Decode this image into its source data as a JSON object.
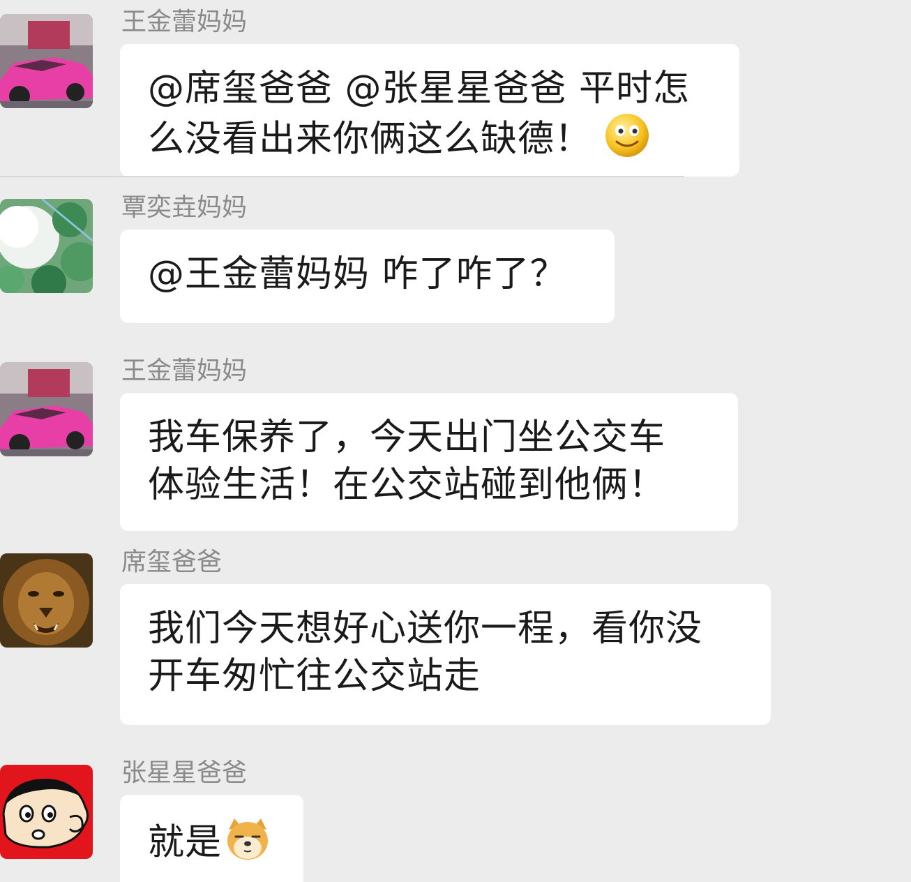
{
  "messages": [
    {
      "sender": "王金蕾妈妈",
      "avatar": "pink-sports-car",
      "lines": [
        "@席玺爸爸 @张星星爸爸 平时怎",
        "么没看出来你俩这么缺德！"
      ],
      "emoji": "smile-emoji"
    },
    {
      "sender": "覃奕垚妈妈",
      "avatar": "green-foliage",
      "lines": [
        "@王金蕾妈妈 咋了咋了？"
      ]
    },
    {
      "sender": "王金蕾妈妈",
      "avatar": "pink-sports-car",
      "lines": [
        "我车保养了，今天出门坐公交车",
        "体验生活！在公交站碰到他俩！"
      ]
    },
    {
      "sender": "席玺爸爸",
      "avatar": "lion",
      "lines": [
        "我们今天想好心送你一程，看你没",
        "开车匆忙往公交站走"
      ]
    },
    {
      "sender": "张星星爸爸",
      "avatar": "cartoon-boy",
      "lines": [
        "就是"
      ],
      "emoji": "doge-emoji"
    }
  ],
  "colors": {
    "background": "#ececec",
    "bubble": "#ffffff",
    "sender_text": "#8a8a8a",
    "message_text": "#1a1a1a"
  }
}
